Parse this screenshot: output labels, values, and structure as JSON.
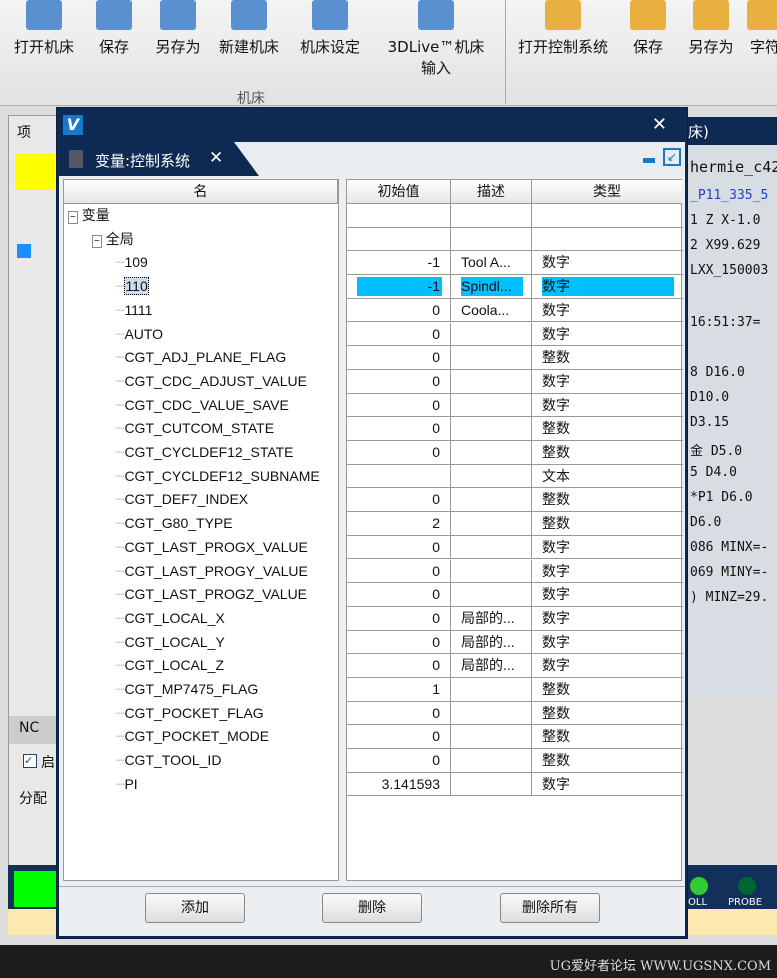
{
  "ribbon": {
    "machine_buttons": [
      "打开机床",
      "保存",
      "另存为",
      "新建机床",
      "机床设定",
      "3DLive™机床输入"
    ],
    "group_label": "机床",
    "control_buttons": [
      "打开控制系统",
      "保存",
      "另存为",
      "字符"
    ]
  },
  "background": {
    "left_tab": "项",
    "nc_label": "NC",
    "checkbox_label": "启",
    "assign_label": "分配",
    "right_title": "床)",
    "code_lines": [
      "hermie_c42",
      "_P11_335_5",
      "1 Z X-1.0",
      "2 X99.629",
      "LXX_150003",
      "16:51:37=",
      "8  D16.0 ",
      "   D10.0 ",
      "   D3.15 ",
      "金   D5.0",
      "5  D4.0 ",
      "*P1 D6.0 ",
      "   D6.0 ",
      "086 MINX=-",
      "069 MINY=-",
      ") MINZ=29."
    ],
    "status_lights": [
      "OLL",
      "PROBE"
    ],
    "watermark": "UG爱好者论坛 WWW.UGSNX.COM"
  },
  "dialog": {
    "tab_title": "变量:控制系统",
    "columns": {
      "name": "名",
      "initial": "初始值",
      "desc": "描述",
      "type": "类型"
    },
    "tree_root": "变量",
    "tree_group": "全局",
    "rows": [
      {
        "name": "109",
        "value": "-1",
        "desc": "Tool A...",
        "type": "数字"
      },
      {
        "name": "110",
        "value": "-1",
        "desc": "Spindl...",
        "type": "数字",
        "selected": true
      },
      {
        "name": "1111",
        "value": "0",
        "desc": "Coola...",
        "type": "数字"
      },
      {
        "name": "AUTO",
        "value": "0",
        "desc": "",
        "type": "数字"
      },
      {
        "name": "CGT_ADJ_PLANE_FLAG",
        "value": "0",
        "desc": "",
        "type": "整数"
      },
      {
        "name": "CGT_CDC_ADJUST_VALUE",
        "value": "0",
        "desc": "",
        "type": "数字"
      },
      {
        "name": "CGT_CDC_VALUE_SAVE",
        "value": "0",
        "desc": "",
        "type": "数字"
      },
      {
        "name": "CGT_CUTCOM_STATE",
        "value": "0",
        "desc": "",
        "type": "整数"
      },
      {
        "name": "CGT_CYCLDEF12_STATE",
        "value": "0",
        "desc": "",
        "type": "整数"
      },
      {
        "name": "CGT_CYCLDEF12_SUBNAME",
        "value": "",
        "desc": "",
        "type": "文本"
      },
      {
        "name": "CGT_DEF7_INDEX",
        "value": "0",
        "desc": "",
        "type": "整数"
      },
      {
        "name": "CGT_G80_TYPE",
        "value": "2",
        "desc": "",
        "type": "整数"
      },
      {
        "name": "CGT_LAST_PROGX_VALUE",
        "value": "0",
        "desc": "",
        "type": "数字"
      },
      {
        "name": "CGT_LAST_PROGY_VALUE",
        "value": "0",
        "desc": "",
        "type": "数字"
      },
      {
        "name": "CGT_LAST_PROGZ_VALUE",
        "value": "0",
        "desc": "",
        "type": "数字"
      },
      {
        "name": "CGT_LOCAL_X",
        "value": "0",
        "desc": "局部的...",
        "type": "数字"
      },
      {
        "name": "CGT_LOCAL_Y",
        "value": "0",
        "desc": "局部的...",
        "type": "数字"
      },
      {
        "name": "CGT_LOCAL_Z",
        "value": "0",
        "desc": "局部的...",
        "type": "数字"
      },
      {
        "name": "CGT_MP7475_FLAG",
        "value": "1",
        "desc": "",
        "type": "整数"
      },
      {
        "name": "CGT_POCKET_FLAG",
        "value": "0",
        "desc": "",
        "type": "整数"
      },
      {
        "name": "CGT_POCKET_MODE",
        "value": "0",
        "desc": "",
        "type": "整数"
      },
      {
        "name": "CGT_TOOL_ID",
        "value": "0",
        "desc": "",
        "type": "整数"
      },
      {
        "name": "PI",
        "value": "3.141593",
        "desc": "",
        "type": "数字"
      }
    ],
    "buttons": {
      "add": "添加",
      "delete": "删除",
      "delete_all": "删除所有"
    },
    "selection_color": "#00bfff"
  }
}
